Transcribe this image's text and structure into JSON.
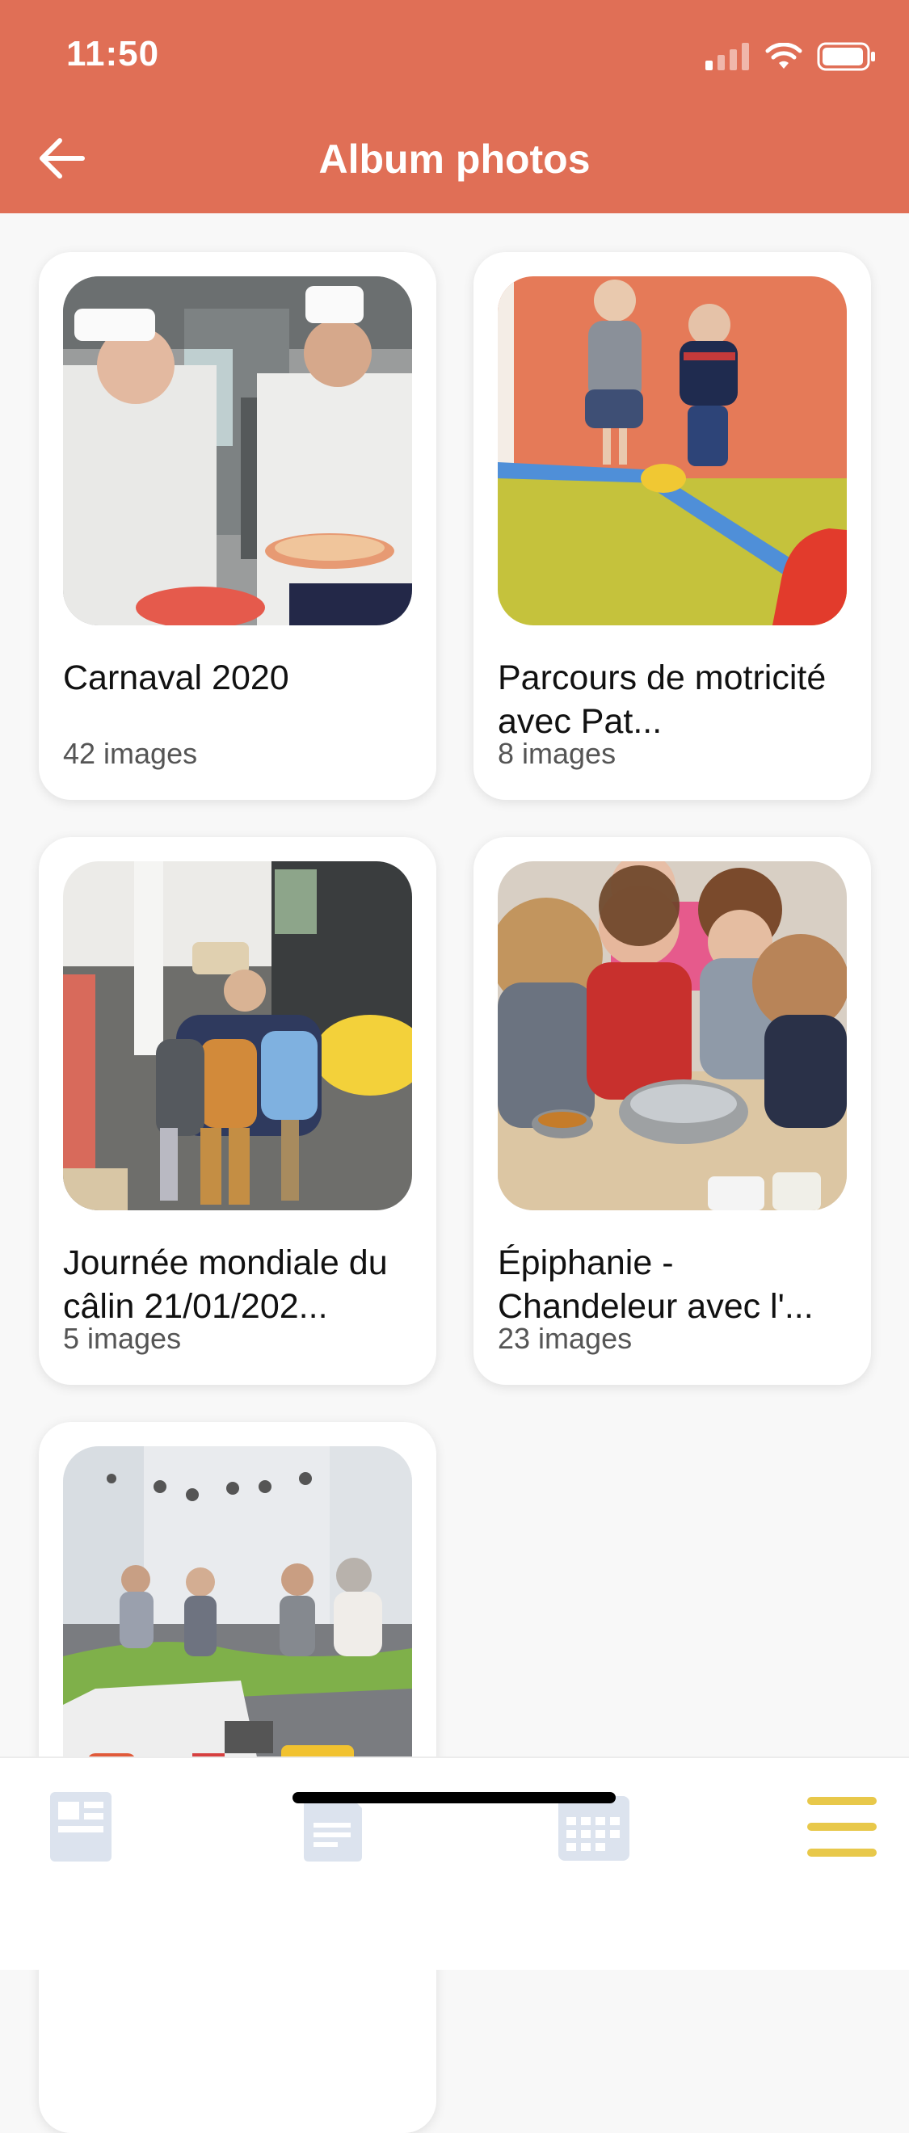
{
  "status_bar": {
    "time": "11:50"
  },
  "header": {
    "title": "Album photos"
  },
  "albums": [
    {
      "title": "Carnaval 2020",
      "count": "42 images"
    },
    {
      "title": "Parcours de motricité avec Pat...",
      "count": "8 images"
    },
    {
      "title": "Journée mondiale du câlin 21/01/202...",
      "count": "5 images"
    },
    {
      "title": "Épiphanie - Chandeleur avec l'...",
      "count": "23 images"
    },
    {
      "title": "",
      "count": ""
    }
  ],
  "bottom_nav": {
    "items": [
      "news-icon",
      "document-icon",
      "calendar-icon",
      "menu-icon"
    ],
    "active_index": 3,
    "active_color": "#E8C84A",
    "inactive_color": "#DCE3EE"
  },
  "colors": {
    "accent": "#E06F56"
  }
}
